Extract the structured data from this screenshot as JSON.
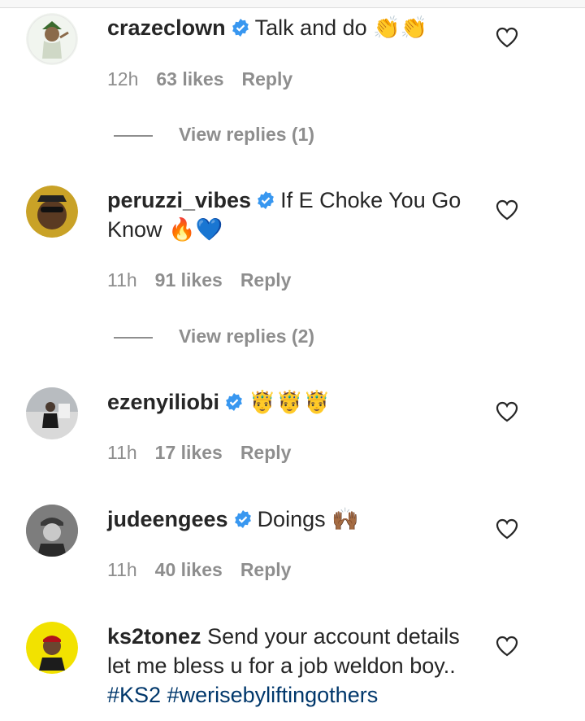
{
  "comments": [
    {
      "username": "crazeclown",
      "text": "Talk and do 👏👏",
      "time": "12h",
      "likes": "63 likes",
      "reply_label": "Reply",
      "view_replies": "View replies (1)"
    },
    {
      "username": "peruzzi_vibes",
      "text": "If E Choke You Go Know 🔥💙",
      "time": "11h",
      "likes": "91 likes",
      "reply_label": "Reply",
      "view_replies": "View replies (2)"
    },
    {
      "username": "ezenyiliobi",
      "text": "🤴🤴🤴",
      "time": "11h",
      "likes": "17 likes",
      "reply_label": "Reply"
    },
    {
      "username": "judeengees",
      "text": "Doings 🙌🏾",
      "time": "11h",
      "likes": "40 likes",
      "reply_label": "Reply"
    },
    {
      "username": "ks2tonez",
      "text": "Send your account details let me bless u for a job weldon boy..",
      "hashtag1": "#KS2",
      "hashtag2": "#werisebyliftingothers"
    }
  ],
  "colors": {
    "verified_badge": "#3897f0",
    "meta_text": "#8e8e8e",
    "hashtag": "#00376b"
  }
}
